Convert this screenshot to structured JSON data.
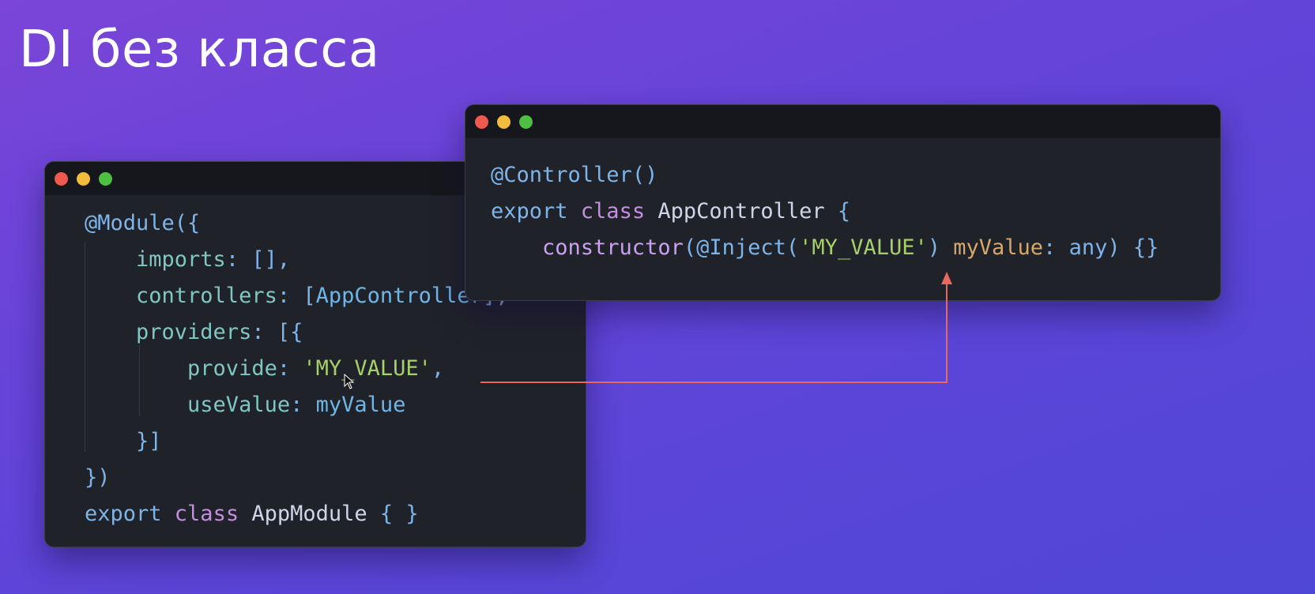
{
  "slide": {
    "title": "DI без класса"
  },
  "colors": {
    "background_start": "#7a45d8",
    "background_end": "#4f47d6",
    "editor_bg": "#20222a",
    "titlebar_bg": "#16171c",
    "dot_close": "#ef5a4f",
    "dot_minimize": "#f2bd3c",
    "dot_maximize": "#4fbf44",
    "arrow": "#e8675f"
  },
  "left_editor": {
    "lines": [
      [
        {
          "t": "@Module",
          "c": "t-dec"
        },
        {
          "t": "({",
          "c": "t-punc"
        }
      ],
      [
        {
          "t": "    imports",
          "c": "t-prop"
        },
        {
          "t": ": [],",
          "c": "t-punc"
        }
      ],
      [
        {
          "t": "    controllers",
          "c": "t-prop"
        },
        {
          "t": ": [",
          "c": "t-punc"
        },
        {
          "t": "AppController",
          "c": "t-id"
        },
        {
          "t": "],",
          "c": "t-punc"
        }
      ],
      [
        {
          "t": "    providers",
          "c": "t-prop"
        },
        {
          "t": ": [{",
          "c": "t-punc"
        }
      ],
      [
        {
          "t": "        provide",
          "c": "t-prop"
        },
        {
          "t": ": ",
          "c": "t-punc"
        },
        {
          "t": "'MY_VALUE'",
          "c": "t-str"
        },
        {
          "t": ",",
          "c": "t-punc"
        }
      ],
      [
        {
          "t": "        useValue",
          "c": "t-prop"
        },
        {
          "t": ": ",
          "c": "t-punc"
        },
        {
          "t": "myValue",
          "c": "t-id"
        }
      ],
      [
        {
          "t": "    }]",
          "c": "t-punc"
        }
      ],
      [
        {
          "t": "})",
          "c": "t-punc"
        }
      ],
      [
        {
          "t": "export ",
          "c": "t-kw"
        },
        {
          "t": "class ",
          "c": "t-kw2"
        },
        {
          "t": "AppModule ",
          "c": "t-cls"
        },
        {
          "t": "{ }",
          "c": "t-punc"
        }
      ]
    ]
  },
  "right_editor": {
    "lines": [
      [
        {
          "t": "@Controller",
          "c": "t-dec"
        },
        {
          "t": "()",
          "c": "t-punc"
        }
      ],
      [
        {
          "t": "export ",
          "c": "t-kw"
        },
        {
          "t": "class ",
          "c": "t-kw2"
        },
        {
          "t": "AppController ",
          "c": "t-cls"
        },
        {
          "t": "{",
          "c": "t-punc"
        }
      ],
      [
        {
          "t": "    constructor",
          "c": "t-fn"
        },
        {
          "t": "(",
          "c": "t-punc"
        },
        {
          "t": "@Inject",
          "c": "t-dec"
        },
        {
          "t": "(",
          "c": "t-punc"
        },
        {
          "t": "'MY_VALUE'",
          "c": "t-str"
        },
        {
          "t": ") ",
          "c": "t-punc"
        },
        {
          "t": "myValue",
          "c": "t-param"
        },
        {
          "t": ": ",
          "c": "t-punc"
        },
        {
          "t": "any",
          "c": "t-type"
        },
        {
          "t": ") {}",
          "c": "t-punc"
        }
      ]
    ]
  }
}
